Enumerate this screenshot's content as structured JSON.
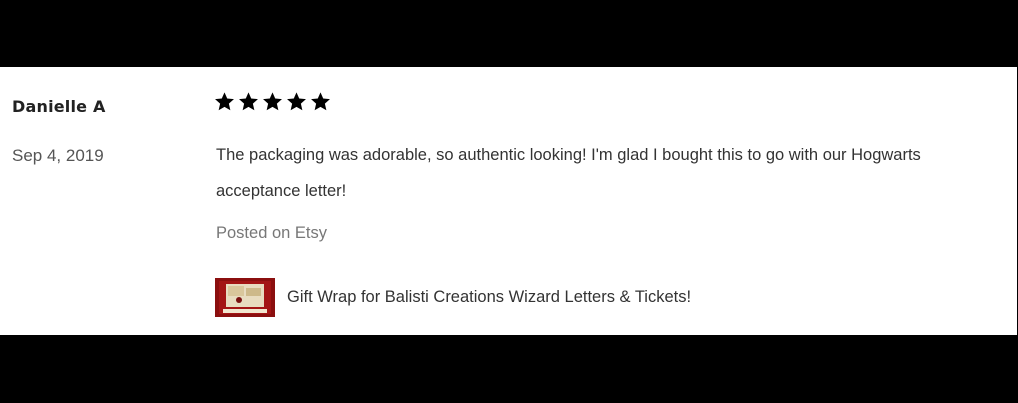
{
  "review": {
    "reviewer_name": "Danielle A",
    "date": "Sep 4, 2019",
    "rating": 5,
    "rating_max": 5,
    "text": "The packaging was adorable, so authentic looking! I'm glad I bought this to go with our Hogwarts acceptance letter!",
    "source": "Posted on Etsy",
    "product": {
      "title": "Gift Wrap for Balisti Creations Wizard Letters & Tickets!",
      "thumbnail_icon": "gift-wrap-product-thumbnail"
    }
  },
  "colors": {
    "frame_background": "#000000",
    "card_background": "#ffffff",
    "star": "#000000",
    "text_primary": "#333333",
    "text_muted": "#777777",
    "thumbnail_red": "#8b0f0f"
  }
}
